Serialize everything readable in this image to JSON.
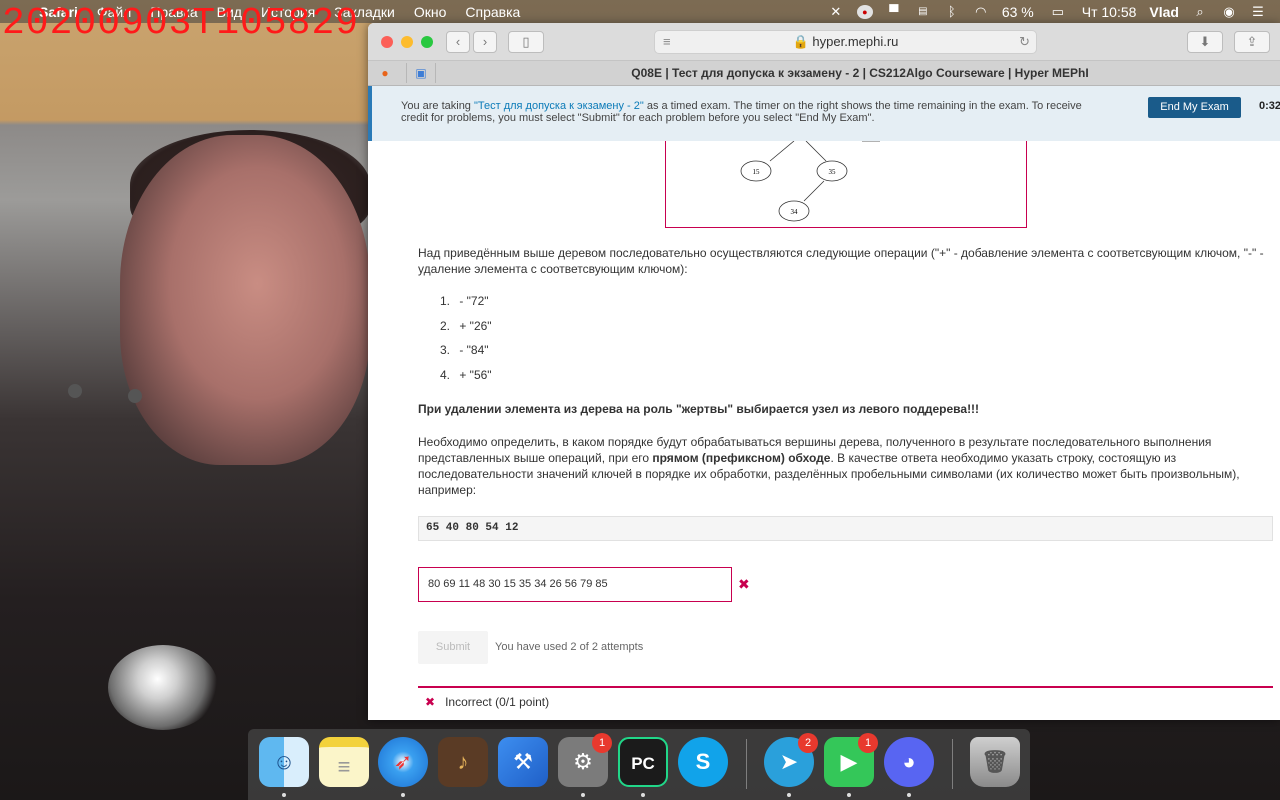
{
  "overlay": {
    "watermark": "20200903T105829"
  },
  "menubar": {
    "items": [
      "Safari",
      "Файл",
      "Правка",
      "Вид",
      "История",
      "Закладки",
      "Окно",
      "Справка"
    ],
    "battery": "63 %",
    "clock": "Чт 10:58",
    "user": "Vlad",
    "icons": [
      "apple-logo",
      "mute-icon",
      "notification-icon",
      "flag-icon",
      "bluetooth-icon",
      "wifi-icon",
      "battery-icon",
      "search-icon",
      "siri-icon",
      "control-icon"
    ]
  },
  "browser": {
    "url": "hyper.mephi.ru",
    "tab_title": "Q08E | Тест для допуска к экзамену - 2 | CS212Algo Courseware | Hyper MEPhI"
  },
  "exam_banner": {
    "prefix": "You are taking ",
    "exam_name": "\"Тест для допуска к экзамену - 2\"",
    "suffix": " as a timed exam. The timer on the right shows the time remaining in the exam. To receive credit for problems, you must select \"Submit\" for each problem before you select \"End My Exam\".",
    "end_button": "End My Exam",
    "timer": "0:32:"
  },
  "tree": {
    "nodes": [
      {
        "label": "15"
      },
      {
        "label": "35"
      },
      {
        "label": "34"
      }
    ]
  },
  "question": {
    "intro": "Над приведённым выше деревом последовательно осуществляются следующие операции (\"+\" - добавление элемента с соответсвующим ключом, \"-\" - удаление элемента с соответсвующим ключом):",
    "operations": [
      {
        "num": "1.",
        "text": "- \"72\""
      },
      {
        "num": "2.",
        "text": "+ \"26\""
      },
      {
        "num": "3.",
        "text": "- \"84\""
      },
      {
        "num": "4.",
        "text": "+ \"56\""
      }
    ],
    "rule": "При удалении элемента из дерева на роль \"жертвы\" выбирается узел из левого поддерева!!!",
    "task_part1": "Необходимо определить, в каком порядке будут обрабатываться вершины дерева, полученного в результате последовательного выполнения представленных выше операций, при его ",
    "task_bold": "прямом (префиксном) обходе",
    "task_part2": ". В качестве ответа необходимо указать строку, состоящую из последовательности значений ключей в порядке их обработки, разделённых пробельными символами (их количество может быть произвольным), например:",
    "example": "65 40 80 54 12",
    "answer_value": "80 69 11 48 30 15 35 34 26 56 79 85",
    "submit_label": "Submit",
    "attempts": "You have used 2 of 2 attempts",
    "result": "Incorrect (0/1 point)"
  },
  "dock": {
    "apps": [
      {
        "name": "finder",
        "badge": ""
      },
      {
        "name": "notes",
        "badge": ""
      },
      {
        "name": "safari",
        "badge": ""
      },
      {
        "name": "garageband",
        "badge": ""
      },
      {
        "name": "xcode",
        "badge": ""
      },
      {
        "name": "system-preferences",
        "badge": "1"
      },
      {
        "name": "pycharm",
        "badge": ""
      },
      {
        "name": "skype",
        "badge": ""
      },
      {
        "name": "telegram",
        "badge": "2"
      },
      {
        "name": "facetime",
        "badge": "1"
      },
      {
        "name": "discord",
        "badge": ""
      },
      {
        "name": "trash",
        "badge": ""
      }
    ]
  }
}
